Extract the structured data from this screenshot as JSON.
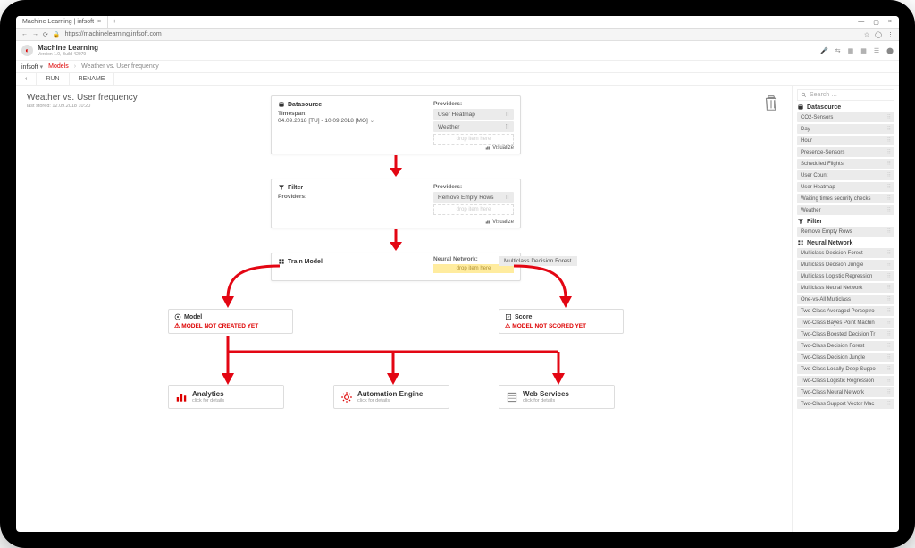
{
  "browser": {
    "tab_title": "Machine Learning | infsoft",
    "close_glyph": "×",
    "new_tab": "+",
    "min": "—",
    "max": "▢",
    "close": "×",
    "back": "←",
    "fwd": "→",
    "reload": "⟳",
    "lock": "🔒",
    "url": "https://machinelearning.infsoft.com",
    "star": "☆",
    "person": "◯",
    "dots": "⋮"
  },
  "app": {
    "title": "Machine Learning",
    "sub": "Version 1.0, Build 42079",
    "icon_mic": "🎤",
    "icons": [
      "⇆",
      "▦",
      "▦",
      "☰",
      "⬤"
    ]
  },
  "breadcrumb": {
    "dropdown": "infsoft",
    "models": "Models",
    "sep": "›",
    "current": "Weather vs. User frequency"
  },
  "toolbar": {
    "back": "‹",
    "run": "RUN",
    "rename": "RENAME"
  },
  "model": {
    "title": "Weather vs. User frequency",
    "stored": "last stored: 12.09.2018 10:20"
  },
  "nodes": {
    "datasource": {
      "title": "Datasource",
      "timespan_label": "Timespan:",
      "timespan_val": "04.09.2018 [TU] - 10.09.2018 [MO]",
      "providers_label": "Providers:",
      "providers": [
        "User Heatmap",
        "Weather"
      ],
      "drop": "drop item here",
      "visualize": "Visualize"
    },
    "filter": {
      "title": "Filter",
      "providers_label": "Providers:",
      "p_label": "Providers:",
      "items": [
        "Remove Empty Rows"
      ],
      "drop": "drop item here",
      "visualize": "Visualize"
    },
    "train": {
      "title": "Train Model",
      "nn_label": "Neural Network:",
      "drop": "drop item here",
      "drag_hint": "Multiclass Decision Forest"
    },
    "model_result": {
      "title": "Model",
      "warn": "MODEL NOT CREATED YET"
    },
    "score": {
      "title": "Score",
      "warn": "MODEL NOT SCORED YET"
    }
  },
  "outputs": {
    "analytics": {
      "title": "Analytics",
      "sub": "click for details"
    },
    "automation": {
      "title": "Automation Engine",
      "sub": "click for details"
    },
    "web": {
      "title": "Web Services",
      "sub": "click for details"
    }
  },
  "sidebar": {
    "search": "Search …",
    "sections": [
      {
        "title": "Datasource",
        "items": [
          "CO2-Sensors",
          "Day",
          "Hour",
          "Presence-Sensors",
          "Scheduled Flights",
          "User Count",
          "User Heatmap",
          "Waiting times security checks",
          "Weather"
        ]
      },
      {
        "title": "Filter",
        "items": [
          "Remove Empty Rows"
        ]
      },
      {
        "title": "Neural  Network",
        "items": [
          "Multiclass Decision Forest",
          "Multiclass Decision Jungle",
          "Multiclass Logistic Regression",
          "Multiclass Neural Network",
          "One-vs-All Multiclass",
          "Two-Class Averaged Perceptro",
          "Two-Class Bayes Point Machin",
          "Two-Class Boosted Decision Tr",
          "Two-Class Decision Forest",
          "Two-Class Decision Jungle",
          "Two-Class Locally-Deep Suppo",
          "Two-Class Logistic Regression",
          "Two-Class Neural Network",
          "Two-Class Support Vector Mac"
        ]
      }
    ]
  }
}
